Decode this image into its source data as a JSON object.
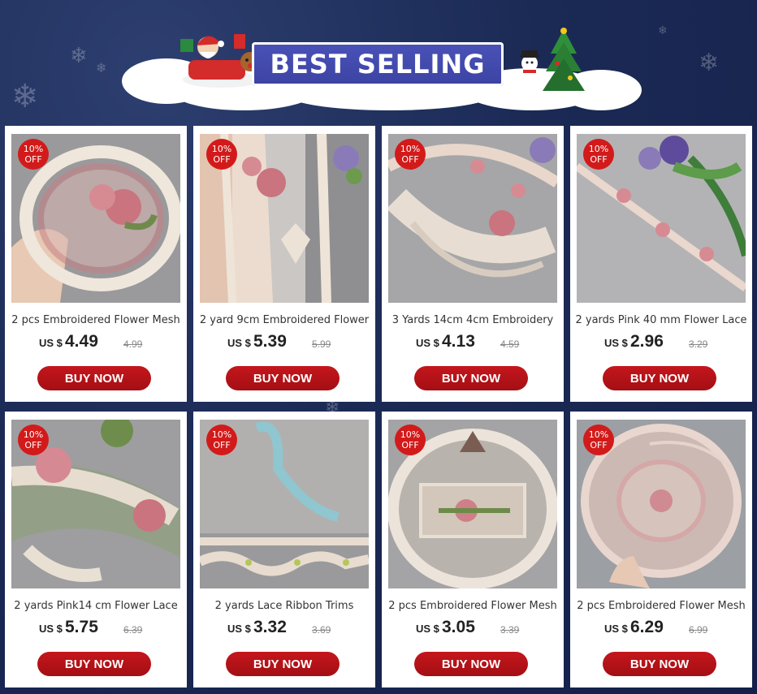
{
  "banner": {
    "title": "BEST SELLING"
  },
  "colors": {
    "badge": "#d31a1a",
    "button": "#b4121a",
    "background": "#1b2a55",
    "banner": "#4048ad"
  },
  "products": [
    {
      "discount_1": "10%",
      "discount_2": "OFF",
      "title": "2 pcs  Embroidered Flower Mesh",
      "currency": "US $",
      "price": "4.49",
      "old_price": "4.99",
      "button": "BUY NOW"
    },
    {
      "discount_1": "10%",
      "discount_2": "OFF",
      "title": "2 yard 9cm  Embroidered Flower",
      "currency": "US $",
      "price": "5.39",
      "old_price": "5.99",
      "button": "BUY NOW"
    },
    {
      "discount_1": "10%",
      "discount_2": "OFF",
      "title": "3 Yards 14cm 4cm  Embroidery",
      "currency": "US $",
      "price": "4.13",
      "old_price": "4.59",
      "button": "BUY NOW"
    },
    {
      "discount_1": "10%",
      "discount_2": "OFF",
      "title": "2 yards Pink 40 mm Flower Lace",
      "currency": "US $",
      "price": "2.96",
      "old_price": "3.29",
      "button": "BUY NOW"
    },
    {
      "discount_1": "10%",
      "discount_2": "OFF",
      "title": "2 yards Pink14 cm Flower Lace",
      "currency": "US $",
      "price": "5.75",
      "old_price": "6.39",
      "button": "BUY NOW"
    },
    {
      "discount_1": "10%",
      "discount_2": "OFF",
      "title": "2 yards Lace  Ribbon Trims",
      "currency": "US $",
      "price": "3.32",
      "old_price": "3.69",
      "button": "BUY NOW"
    },
    {
      "discount_1": "10%",
      "discount_2": "OFF",
      "title": "2 pcs  Embroidered Flower Mesh",
      "currency": "US $",
      "price": "3.05",
      "old_price": "3.39",
      "button": "BUY NOW"
    },
    {
      "discount_1": "10%",
      "discount_2": "OFF",
      "title": "2 pcs  Embroidered Flower Mesh",
      "currency": "US $",
      "price": "6.29",
      "old_price": "6.99",
      "button": "BUY NOW"
    }
  ]
}
